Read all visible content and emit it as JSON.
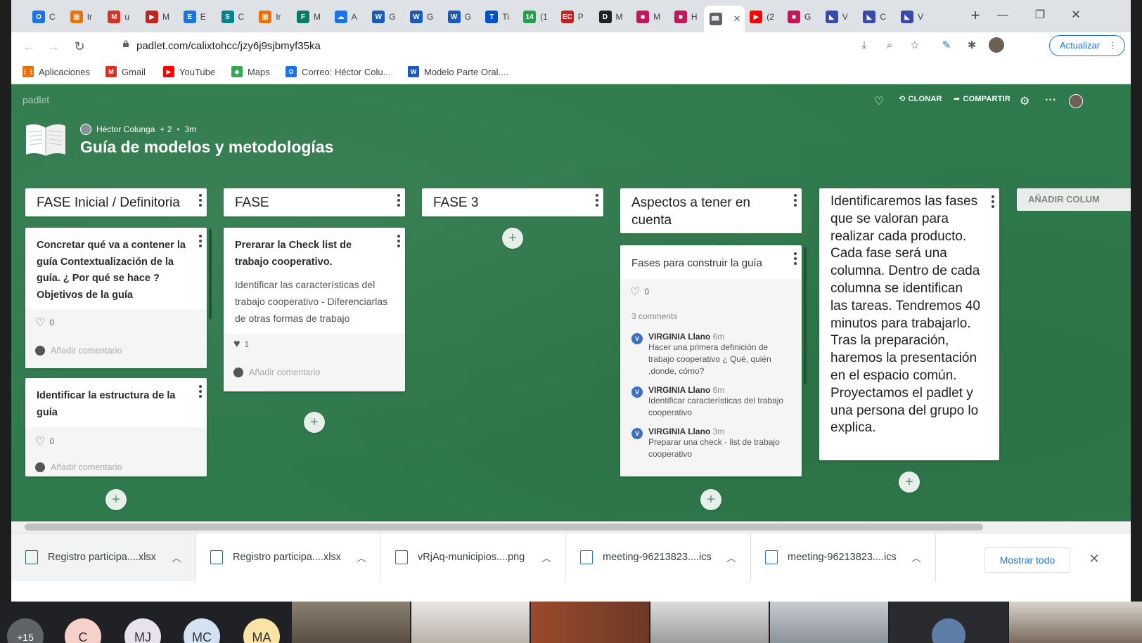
{
  "browser": {
    "tabs": [
      {
        "label": "C",
        "color": "#1a73e8",
        "glyph": "O"
      },
      {
        "label": "Ir",
        "color": "#e8710a",
        "glyph": "▦"
      },
      {
        "label": "u",
        "color": "#d93025",
        "glyph": "M"
      },
      {
        "label": "M",
        "color": "#c5221f",
        "glyph": "▶"
      },
      {
        "label": "E",
        "color": "#1a73e8",
        "glyph": "E"
      },
      {
        "label": "C",
        "color": "#038387",
        "glyph": "S"
      },
      {
        "label": "Ir",
        "color": "#e8710a",
        "glyph": "▦"
      },
      {
        "label": "M",
        "color": "#0b7a63",
        "glyph": "F"
      },
      {
        "label": "A",
        "color": "#1a73e8",
        "glyph": "☁"
      },
      {
        "label": "G",
        "color": "#185abd",
        "glyph": "W"
      },
      {
        "label": "G",
        "color": "#185abd",
        "glyph": "W"
      },
      {
        "label": "G",
        "color": "#185abd",
        "glyph": "W"
      },
      {
        "label": "Ti",
        "color": "#0052cc",
        "glyph": "T"
      },
      {
        "label": "(1",
        "color": "#23a24d",
        "glyph": "14"
      },
      {
        "label": "P",
        "color": "#c5221f",
        "glyph": "EC"
      },
      {
        "label": "M",
        "color": "#202124",
        "glyph": "D"
      },
      {
        "label": "M",
        "color": "#c2185b",
        "glyph": "■"
      },
      {
        "label": "H",
        "color": "#c2185b",
        "glyph": "■"
      },
      {
        "label": "",
        "color": "#5f6368",
        "glyph": "📖",
        "active": true
      },
      {
        "label": "(2",
        "color": "#ff0000",
        "glyph": "▶"
      },
      {
        "label": "G",
        "color": "#c2185b",
        "glyph": "■"
      },
      {
        "label": "V",
        "color": "#3949ab",
        "glyph": "◣"
      },
      {
        "label": "C",
        "color": "#3949ab",
        "glyph": "◣"
      },
      {
        "label": "V",
        "color": "#3949ab",
        "glyph": "◣"
      }
    ],
    "url": "padlet.com/calixtohcc/jzy6j9sjbmyf35ka",
    "update_label": "Actualizar",
    "bookmarks": [
      {
        "label": "Aplicaciones",
        "color": "#e8710a",
        "glyph": "⋮⋮"
      },
      {
        "label": "Gmail",
        "color": "#d93025",
        "glyph": "M"
      },
      {
        "label": "YouTube",
        "color": "#ff0000",
        "glyph": "▶"
      },
      {
        "label": "Maps",
        "color": "#34a853",
        "glyph": "◆"
      },
      {
        "label": "Correo: Héctor Colu...",
        "color": "#1a73e8",
        "glyph": "O"
      },
      {
        "label": "Modelo Parte Oral....",
        "color": "#185abd",
        "glyph": "W"
      }
    ]
  },
  "padlet": {
    "brand": "padlet",
    "actions": {
      "clone": "CLONAR",
      "share": "COMPARTIR"
    },
    "author": "Héctor Colunga",
    "contributors": "+ 2",
    "age": "3m",
    "title": "Guía de modelos y metodologías",
    "add_column": "AÑADIR COLUM",
    "columns": [
      {
        "header": "FASE Inicial / Definitoria",
        "cards": [
          {
            "title": "Concretar qué va a contener la guía Contextualización de la guía. ¿ Por qué se hace ? Objetivos de la guía",
            "likes": "0",
            "comment_placeholder": "Añadir comentario"
          },
          {
            "title": "Identificar la estructura de la guía",
            "likes": "0",
            "comment_placeholder": "Añadir comentario"
          }
        ]
      },
      {
        "header": "FASE",
        "cards": [
          {
            "title": "Prerarar la Check list de trabajo cooperativo.",
            "body": "Identificar las características del trabajo cooperativo - Diferenciarlas de otras formas de trabajo",
            "likes": "1",
            "comment_placeholder": "Añadir comentario"
          }
        ]
      },
      {
        "header": "FASE 3",
        "cards": []
      },
      {
        "header": "Aspectos a tener en cuenta",
        "cards": [
          {
            "title": "Fases para construir la guía",
            "likes": "0",
            "comments_count": "3 comments",
            "comments": [
              {
                "author": "VIRGINIA Llano",
                "time": "6m",
                "text": "Hacer una primera definición de trabajo cooperativo ¿ Qué, quién ,donde, cómo?"
              },
              {
                "author": "VIRGINIA Llano",
                "time": "6m",
                "text": "Identificar características del trabajo cooperativo"
              },
              {
                "author": "VIRGINIA Llano",
                "time": "3m",
                "text": "Preparar una check - list de trabajo cooperativo"
              }
            ]
          }
        ]
      }
    ],
    "note": "Identificaremos las fases que se valoran para realizar cada producto. Cada fase será una columna. Dentro de cada columna se identifican las tareas. Tendremos 40 minutos para trabajarlo. Tras la preparación, haremos la presentación en el espacio común. Proyectamos el padlet y una persona del grupo lo explica."
  },
  "downloads": {
    "items": [
      {
        "name": "Registro participa....xlsx",
        "type": "excel"
      },
      {
        "name": "Registro participa....xlsx",
        "type": "excel"
      },
      {
        "name": "vRjAq-municipios....png",
        "type": "image"
      },
      {
        "name": "meeting-96213823....ics",
        "type": "calendar"
      },
      {
        "name": "meeting-96213823....ics",
        "type": "calendar"
      }
    ],
    "show_all": "Mostrar todo"
  },
  "meeting": {
    "overflow": "+15",
    "participants": [
      {
        "initials": "C",
        "color": "#f6d1c9"
      },
      {
        "initials": "MJ",
        "color": "#e7e2ee"
      },
      {
        "initials": "MC",
        "color": "#d3e3f3"
      },
      {
        "initials": "MA",
        "color": "#f9e3a5"
      }
    ]
  }
}
